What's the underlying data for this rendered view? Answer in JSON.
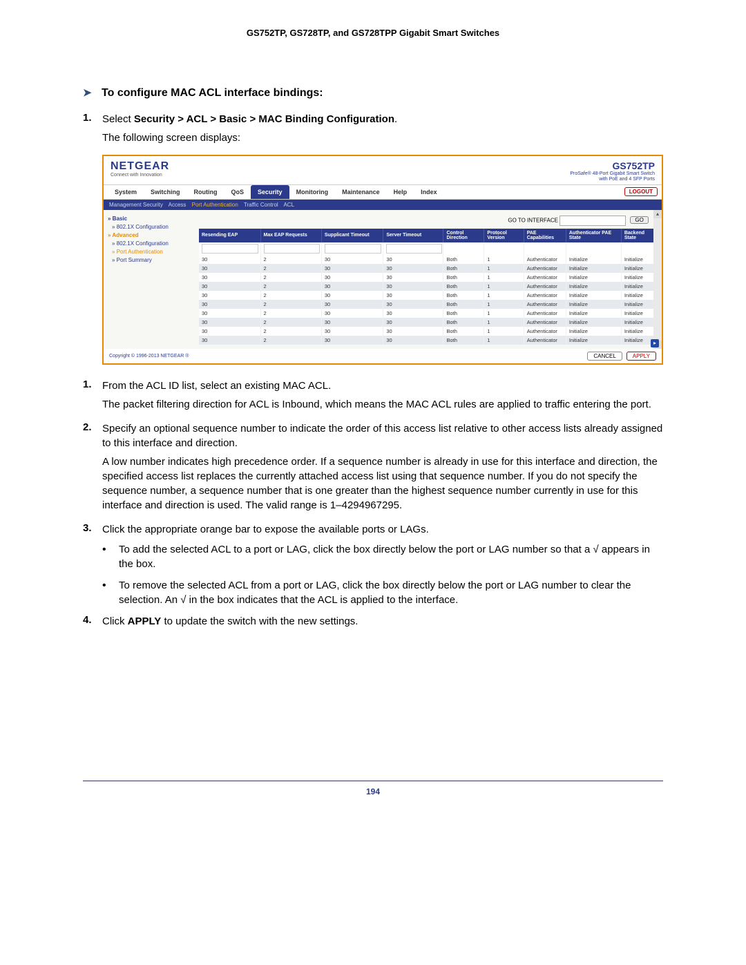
{
  "doc_header": "GS752TP, GS728TP, and GS728TPP Gigabit Smart Switches",
  "section_title": "To configure MAC ACL interface bindings:",
  "intro_step": {
    "num": "1.",
    "pre": "Select ",
    "path": "Security > ACL > Basic > MAC Binding Configuration",
    "post": "."
  },
  "intro_sub": "The following screen displays:",
  "screenshot": {
    "logo": "NETGEAR",
    "logo_sub": "Connect with Innovation",
    "model": "GS752TP",
    "model_sub1": "ProSafe® 48-Port Gigabit Smart Switch",
    "model_sub2": "with PoE and 4 SFP Ports",
    "topnav": [
      "System",
      "Switching",
      "Routing",
      "QoS",
      "Security",
      "Monitoring",
      "Maintenance",
      "Help",
      "Index"
    ],
    "topnav_active": "Security",
    "logout": "LOGOUT",
    "subnav": [
      "Management Security",
      "Access",
      "Port Authentication",
      "Traffic Control",
      "ACL"
    ],
    "subnav_active": "Port Authentication",
    "sidebar": {
      "basic": "Basic",
      "dot1x": "802.1X Configuration",
      "advanced": "Advanced",
      "dot1x2": "802.1X Configuration",
      "port_auth": "Port Authentication",
      "port_summary": "Port Summary"
    },
    "go_label": "GO TO INTERFACE",
    "go_btn": "GO",
    "columns": [
      "Resending EAP",
      "Max EAP Requests",
      "Supplicant Timeout",
      "Server Timeout",
      "Control Direction",
      "Protocol Version",
      "PAE Capabilities",
      "Authenticator PAE State",
      "Backend State"
    ],
    "row": [
      "30",
      "2",
      "30",
      "30",
      "Both",
      "1",
      "Authenticator",
      "Initialize",
      "Initialize"
    ],
    "footer_copy": "Copyright © 1996-2013 NETGEAR ®",
    "cancel": "CANCEL",
    "apply": "APPLY"
  },
  "steps_after": [
    {
      "num": "1.",
      "text": "From the ACL ID list, select an existing MAC ACL.",
      "para": "The packet filtering direction for ACL is Inbound, which means the MAC ACL rules are applied to traffic entering the port."
    },
    {
      "num": "2.",
      "text": "Specify an optional sequence number to indicate the order of this access list relative to other access lists already assigned to this interface and direction.",
      "para": "A low number indicates high precedence order. If a sequence number is already in use for this interface and direction, the specified access list replaces the currently attached access list using that sequence number. If you do not specify the sequence number, a sequence number that is one greater than the highest sequence number currently in use for this interface and direction is used. The valid range is 1–4294967295."
    },
    {
      "num": "3.",
      "text": "Click the appropriate orange bar to expose the available ports or LAGs.",
      "bullets": [
        "To add the selected ACL to a port or LAG, click the box directly below the port or LAG number so that a √ appears in the box.",
        "To remove the selected ACL from a port or LAG, click the box directly below the port or LAG number to clear the selection. An √ in the box indicates that the ACL is applied to the interface."
      ]
    },
    {
      "num": "4.",
      "pre": "Click ",
      "bold": "APPLY",
      "post": " to update the switch with the new settings."
    }
  ],
  "page_number": "194"
}
